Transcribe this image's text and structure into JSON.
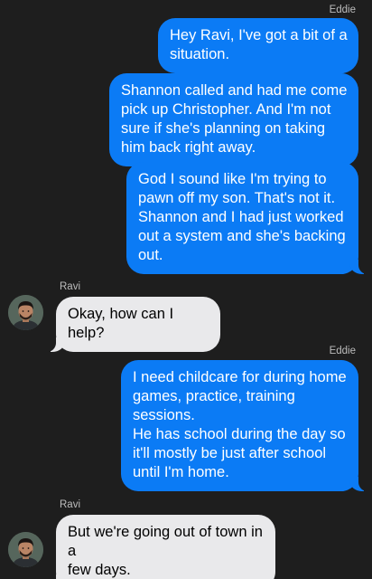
{
  "messages": [
    {
      "id": "m1",
      "direction": "outgoing",
      "sender": "Eddie",
      "text": "Hey Ravi, I've got a bit of a\nsituation."
    },
    {
      "id": "m2",
      "direction": "outgoing",
      "sender": "Eddie",
      "text": "Shannon called and had me come\npick up Christopher. And I'm not\nsure if she's planning on taking\nhim back right away."
    },
    {
      "id": "m3",
      "direction": "outgoing",
      "sender": "Eddie",
      "text": "God I sound like I'm trying to\npawn off my son. That's not it.\nShannon and I had just worked\nout a system and she's backing\nout."
    },
    {
      "id": "m4",
      "direction": "incoming",
      "sender": "Ravi",
      "text": "Okay, how can I help?"
    },
    {
      "id": "m5",
      "direction": "outgoing",
      "sender": "Eddie",
      "text": "I need childcare for during home\ngames, practice, training\nsessions.\nHe has school during the day so\nit'll mostly be just after school\nuntil I'm home."
    },
    {
      "id": "m6",
      "direction": "incoming",
      "sender": "Ravi",
      "text": "But we're going out of town in a\nfew days."
    }
  ],
  "colors": {
    "background": "#1e1e1e",
    "outgoing_bubble": "#0b7bf5",
    "incoming_bubble": "#e9e9eb"
  }
}
